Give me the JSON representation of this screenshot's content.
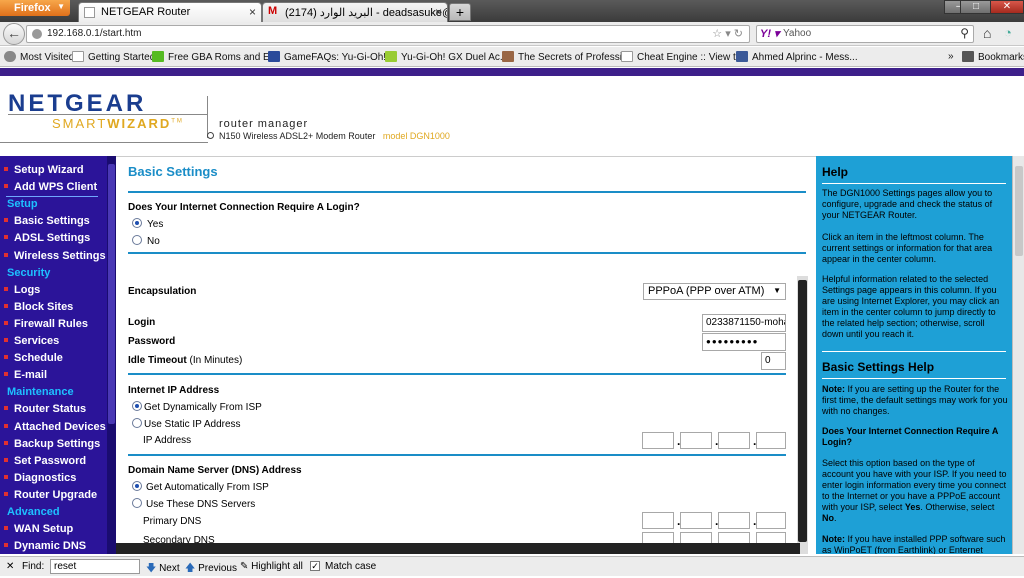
{
  "browser": {
    "menu_label": "Firefox",
    "tabs": [
      {
        "label": "NETGEAR Router"
      },
      {
        "label": "البريد الوارد (2174) - deadsasuke@g..."
      }
    ],
    "new_tab": "+",
    "url": "192.168.0.1/start.htm",
    "search_engine": "Yahoo",
    "search_placeholder": "Yahoo",
    "bookmarks": [
      {
        "label": "Most Visited"
      },
      {
        "label": "Getting Started"
      },
      {
        "label": "Free GBA Roms and E..."
      },
      {
        "label": "GameFAQs: Yu-Gi-Oh!..."
      },
      {
        "label": "Yu-Gi-Oh! GX Duel Ac..."
      },
      {
        "label": "The Secrets of Professi..."
      },
      {
        "label": "Cheat Engine :: View t..."
      },
      {
        "label": "Ahmed Alprinc - Mess..."
      }
    ],
    "bookmarks_menu": "Bookmarks",
    "overflow": "»"
  },
  "router_header": {
    "brand": "NETGEAR",
    "smartwizard_1": "SMART",
    "smartwizard_2": "WIZARD",
    "tm": "TM",
    "product_line": "router manager",
    "product_desc": "N150 Wireless ADSL2+ Modem Router",
    "model": "model DGN1000"
  },
  "menu": {
    "items": [
      {
        "type": "item",
        "label": "Setup Wizard"
      },
      {
        "type": "item",
        "label": "Add WPS Client"
      },
      {
        "type": "heading",
        "label": "Setup"
      },
      {
        "type": "item",
        "label": "Basic Settings"
      },
      {
        "type": "item",
        "label": "ADSL Settings"
      },
      {
        "type": "item",
        "label": "Wireless Settings"
      },
      {
        "type": "heading",
        "label": "Security"
      },
      {
        "type": "item",
        "label": "Logs"
      },
      {
        "type": "item",
        "label": "Block Sites"
      },
      {
        "type": "item",
        "label": "Firewall Rules"
      },
      {
        "type": "item",
        "label": "Services"
      },
      {
        "type": "item",
        "label": "Schedule"
      },
      {
        "type": "item",
        "label": "E-mail"
      },
      {
        "type": "heading",
        "label": "Maintenance"
      },
      {
        "type": "item",
        "label": "Router Status"
      },
      {
        "type": "item",
        "label": "Attached Devices"
      },
      {
        "type": "item",
        "label": "Backup Settings"
      },
      {
        "type": "item",
        "label": "Set Password"
      },
      {
        "type": "item",
        "label": "Diagnostics"
      },
      {
        "type": "item",
        "label": "Router Upgrade"
      },
      {
        "type": "heading",
        "label": "Advanced"
      },
      {
        "type": "item",
        "label": "WAN Setup"
      },
      {
        "type": "item",
        "label": "Dynamic DNS"
      }
    ]
  },
  "main": {
    "title": "Basic Settings",
    "login_question": "Does Your Internet Connection Require A Login?",
    "login_yes": "Yes",
    "login_no": "No",
    "login_selected": "Yes",
    "encapsulation_label": "Encapsulation",
    "encapsulation_value": "PPPoA (PPP over ATM)",
    "login_label": "Login",
    "login_value": "0233871150-moha",
    "password_label": "Password",
    "password_value": "●●●●●●●●●",
    "idle_label": "Idle Timeout",
    "idle_unit": "(In Minutes)",
    "idle_value": "0",
    "ip_section": "Internet IP Address",
    "ip_dynamic": "Get Dynamically From ISP",
    "ip_static": "Use Static IP Address",
    "ip_address_label": "IP Address",
    "ip_selected": "Get Dynamically From ISP",
    "dns_section": "Domain Name Server (DNS) Address",
    "dns_auto": "Get Automatically From ISP",
    "dns_manual": "Use These DNS Servers",
    "dns_selected": "Get Automatically From ISP",
    "primary_dns": "Primary DNS",
    "secondary_dns": "Secondary DNS",
    "ip_separator": "."
  },
  "help": {
    "title": "Help",
    "p1": "The DGN1000 Settings pages allow you to configure, upgrade and check the status of your NETGEAR Router.",
    "p2": "Click an item in the leftmost column. The current settings or information for that area appear in the center column.",
    "p3": "Helpful information related to the selected Settings page appears in this column. If you are using Internet Explorer, you may click an item in the center column to jump directly to the related help section; otherwise, scroll down until you reach it.",
    "title2": "Basic Settings Help",
    "note1_label": "Note:",
    "note1": " If you are setting up the Router for the first time, the default settings may work for you with no changes.",
    "q_title": "Does Your Internet Connection Require A Login?",
    "p4a": "Select this option based on the type of account you have with your ISP. If you need to enter login information every time you connect to the Internet or you have a PPPoE account with your ISP, select ",
    "p4_yes": "Yes",
    "p4b": ". Otherwise, select ",
    "p4_no": "No",
    "p4c": ".",
    "note2_label": "Note:",
    "note2": " If you have installed PPP software such as WinPoET (from Earthlink) or Enternet"
  },
  "findbar": {
    "close": "✕",
    "label": "Find:",
    "value": "reset",
    "next": "Next",
    "previous": "Previous",
    "highlight": "Highlight all",
    "match_case": "Match case"
  },
  "colors": {
    "menu_bg": "#2b1499",
    "menu_heading": "#1ec0ff",
    "accent": "#1a8dc7",
    "help_bg": "#1ea0d6",
    "brand_blue": "#1a3d8f",
    "brand_gold": "#e0a820"
  }
}
